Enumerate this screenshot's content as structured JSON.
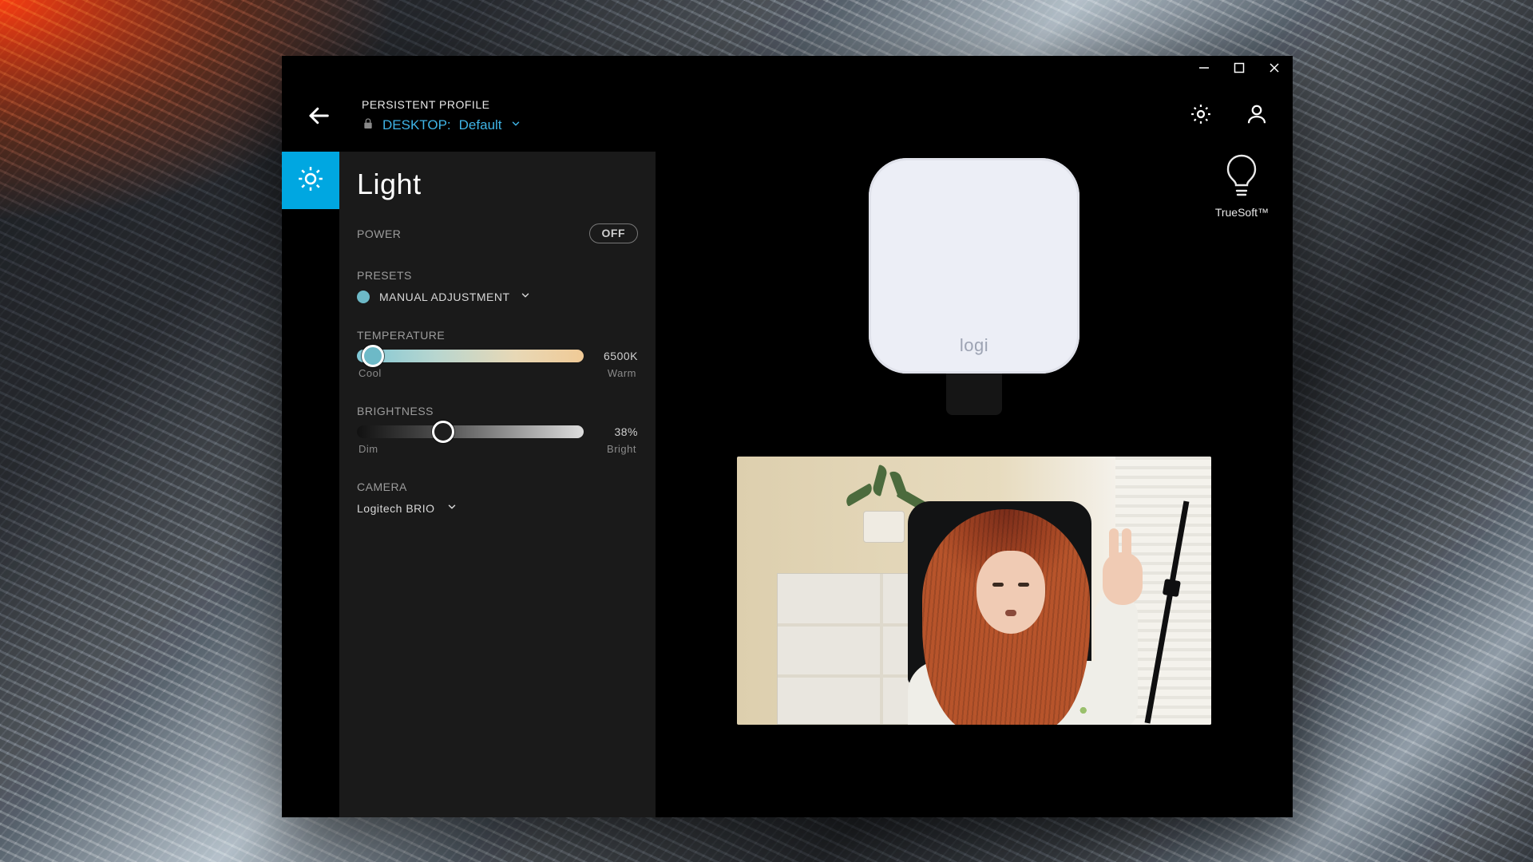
{
  "header": {
    "persistent_label": "PERSISTENT PROFILE",
    "desktop_label": "DESKTOP:",
    "profile_name": "Default"
  },
  "panel": {
    "title": "Light",
    "power": {
      "label": "POWER",
      "value": "OFF"
    },
    "presets": {
      "label": "PRESETS",
      "selected": "MANUAL ADJUSTMENT"
    },
    "temperature": {
      "label": "TEMPERATURE",
      "value_display": "6500K",
      "left_label": "Cool",
      "right_label": "Warm"
    },
    "brightness": {
      "label": "BRIGHTNESS",
      "value_display": "38%",
      "left_label": "Dim",
      "right_label": "Bright"
    },
    "camera": {
      "label": "CAMERA",
      "selected": "Logitech BRIO"
    }
  },
  "main": {
    "truesoft_label": "TrueSoft™",
    "device_logo": "logi"
  }
}
